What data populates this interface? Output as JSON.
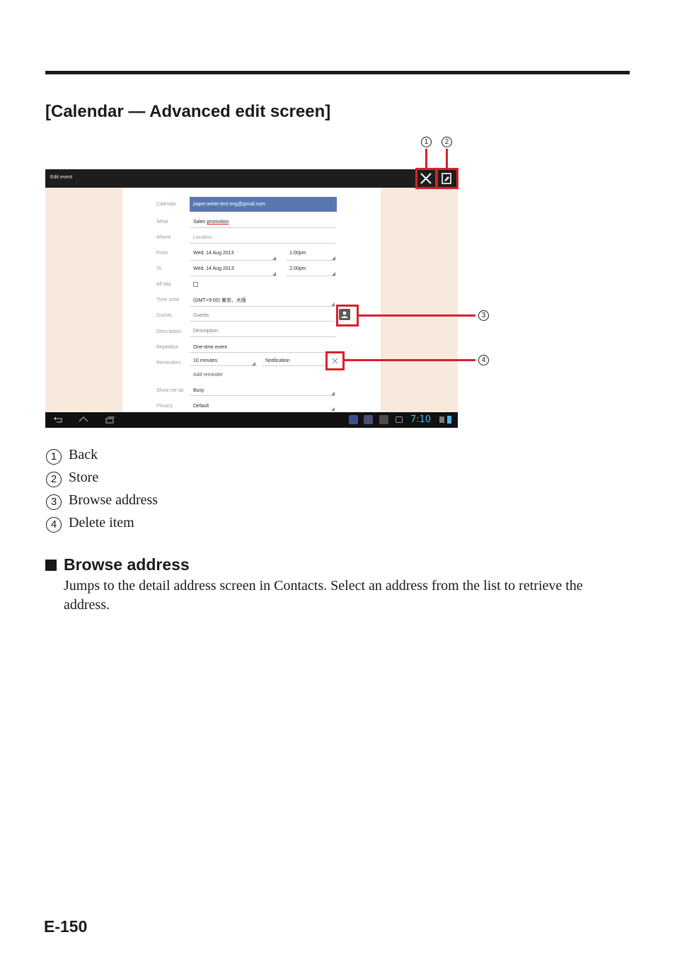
{
  "section_title": "[Calendar — Advanced edit screen]",
  "screenshot": {
    "action_bar_title": "Edit event",
    "fields": {
      "calendar_label": "Calendar",
      "calendar_value": "paper.writer.test.eng@gmail.com",
      "what_label": "What",
      "what_value_prefix": "Sales ",
      "what_value_suffix": "promotion",
      "where_label": "Where",
      "where_placeholder": "Location",
      "from_label": "From",
      "from_date": "Wed, 14 Aug 2013",
      "from_time": "1:00pm",
      "to_label": "To",
      "to_date": "Wed, 14 Aug 2013",
      "to_time": "2:00pm",
      "allday_label": "All day",
      "timezone_label": "Time zone",
      "timezone_value": "(GMT+9:00) 東京、大阪",
      "guests_label": "Guests",
      "guests_placeholder": "Guests",
      "description_label": "Description",
      "description_placeholder": "Description",
      "repetition_label": "Repetition",
      "repetition_value": "One-time event",
      "reminders_label": "Reminders",
      "reminder_time": "10 minutes",
      "reminder_method": "Notification",
      "add_reminder": "Add reminder",
      "showmeas_label": "Show me as",
      "showmeas_value": "Busy",
      "privacy_label": "Privacy",
      "privacy_value": "Default"
    },
    "clock": "7:10",
    "colors": {
      "action_bar": "#1d1d1d",
      "calendar_field": "#5a78b0",
      "side_background": "#f8e9dd",
      "clock": "#4fb3e8",
      "callout": "#d8202c"
    }
  },
  "callout_numbers": [
    "1",
    "2",
    "3",
    "4"
  ],
  "legend": [
    {
      "num": "1",
      "label": "Back"
    },
    {
      "num": "2",
      "label": "Store"
    },
    {
      "num": "3",
      "label": "Browse address"
    },
    {
      "num": "4",
      "label": "Delete item"
    }
  ],
  "subsection": {
    "title": "Browse address",
    "body": "Jumps to the detail address screen in Contacts. Select an address from the list to retrieve the address."
  },
  "page_number": "E-150"
}
